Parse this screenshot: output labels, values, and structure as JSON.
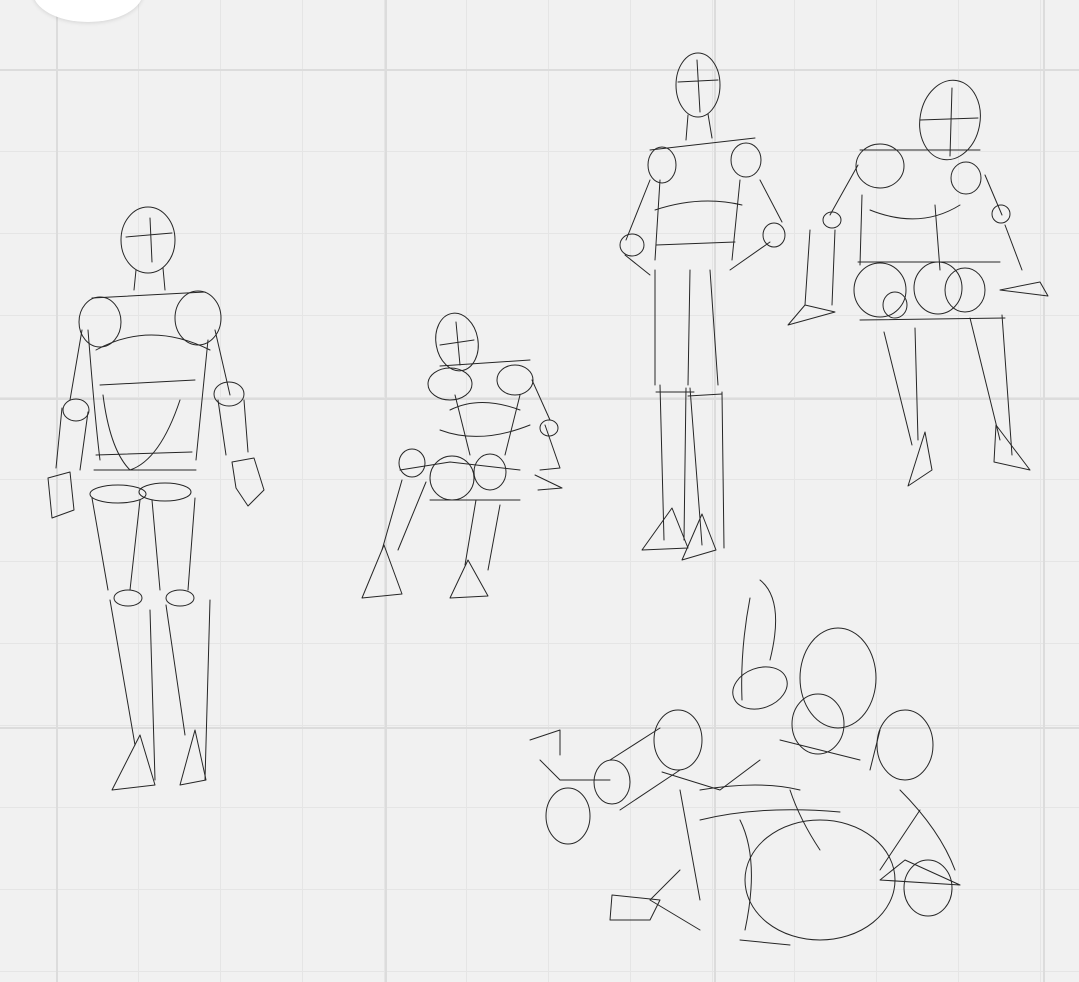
{
  "canvas": {
    "background_color": "#f1f1f1",
    "grid_color": "#dcdcdc",
    "stroke_color": "#262626"
  },
  "corner_control": {
    "icon": "corner-menu-icon"
  },
  "sketches": [
    {
      "id": "standing-figure-front",
      "pose": "standing"
    },
    {
      "id": "sitting-figure-small",
      "pose": "sitting"
    },
    {
      "id": "standing-figure-hands-on-hips",
      "pose": "standing"
    },
    {
      "id": "sitting-figure-leaning-forward",
      "pose": "sitting"
    },
    {
      "id": "reclining-figure-foreshortened",
      "pose": "reclining"
    }
  ]
}
